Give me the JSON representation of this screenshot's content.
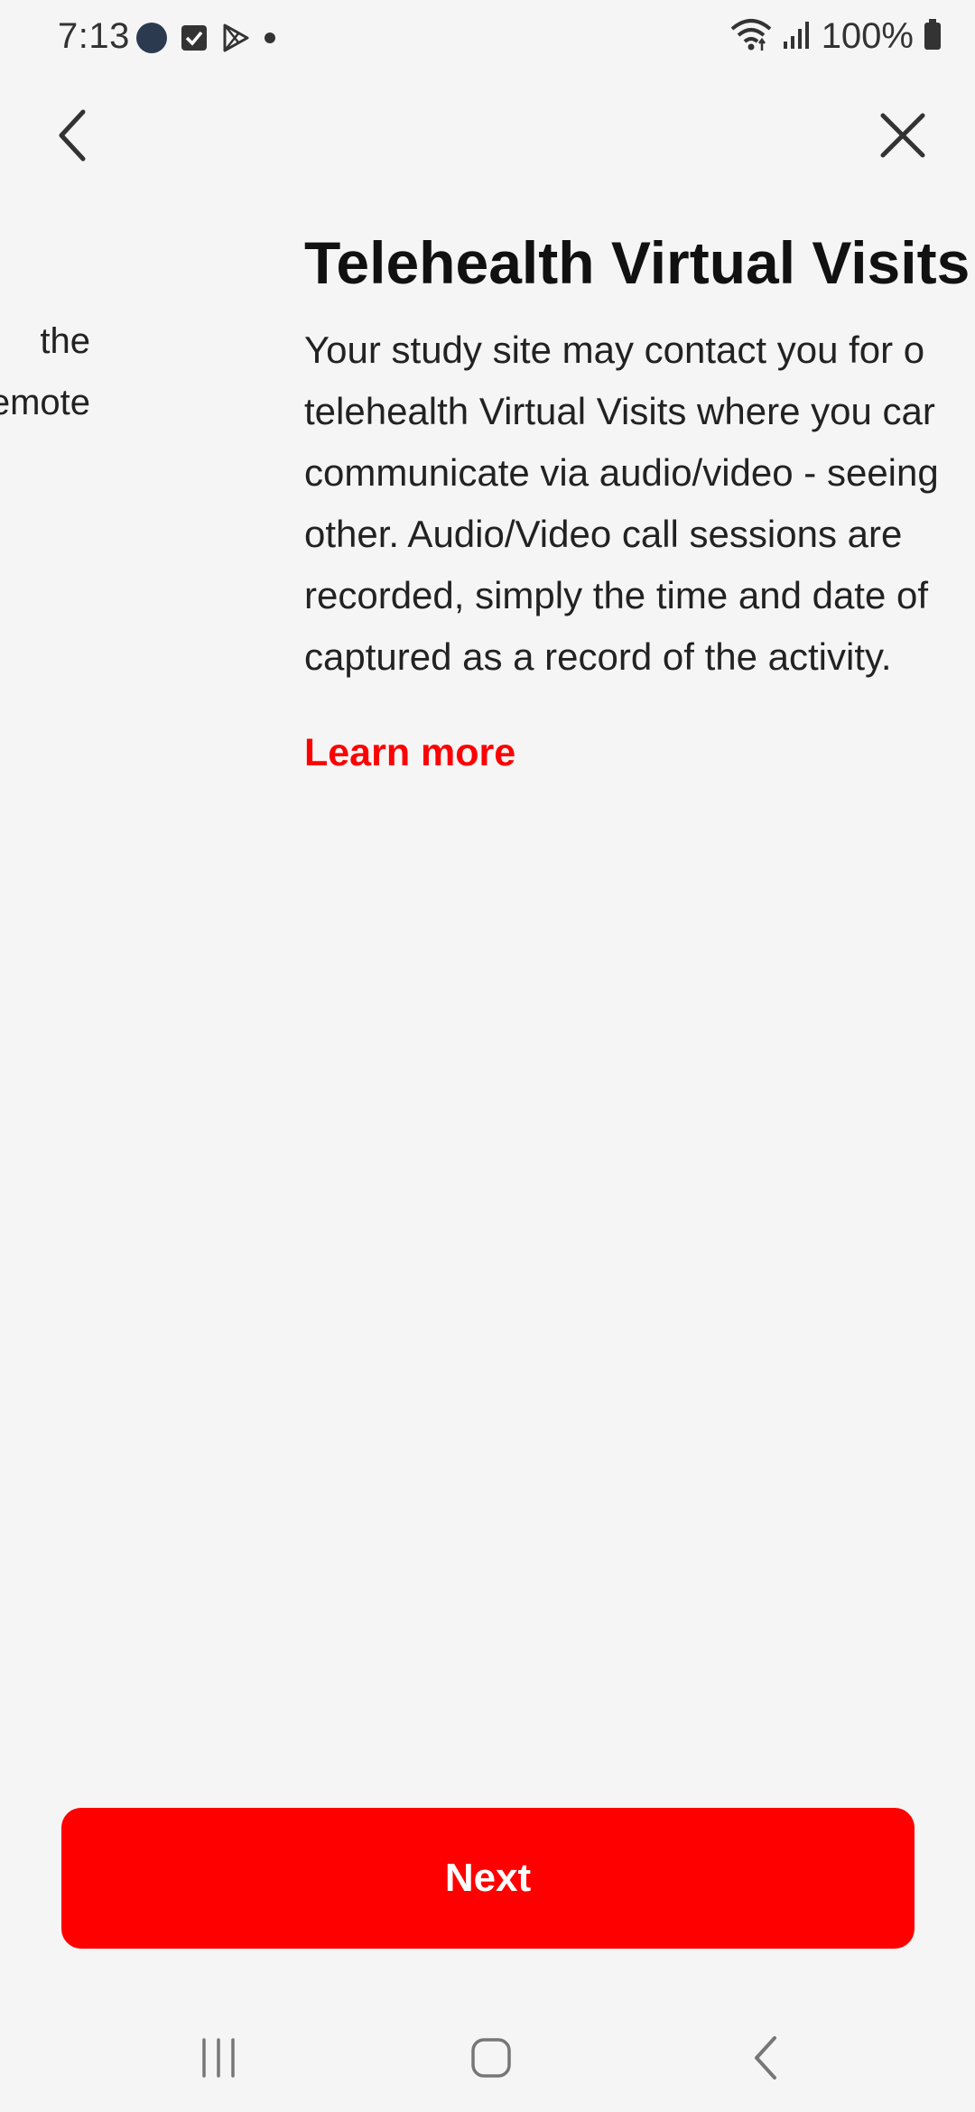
{
  "status_bar": {
    "time": "7:13",
    "battery": "100%",
    "left_icons": [
      "app-icon",
      "checkbox-icon",
      "play-store-icon",
      "dot-icon"
    ],
    "right_icons": [
      "wifi-icon",
      "signal-icon",
      "battery-icon"
    ]
  },
  "header": {
    "back_icon": "chevron-left-icon",
    "close_icon": "close-icon"
  },
  "previous_page": {
    "lines": [
      "the",
      "emote"
    ]
  },
  "page": {
    "title": "Telehealth Virtual Visits",
    "body_lines": [
      "Your study site may contact you for o",
      "telehealth Virtual Visits where you car",
      "communicate via audio/video - seeing",
      "other.  Audio/Video call sessions are",
      "recorded, simply the time and date of",
      "captured as a record of the activity."
    ],
    "learn_more": "Learn more"
  },
  "next_button": {
    "label": "Next"
  },
  "colors": {
    "accent": "#ff0000",
    "background": "#f5f5f6",
    "text": "#111111"
  },
  "nav_bar": {
    "icons": [
      "recents-icon",
      "home-icon",
      "back-icon"
    ]
  }
}
